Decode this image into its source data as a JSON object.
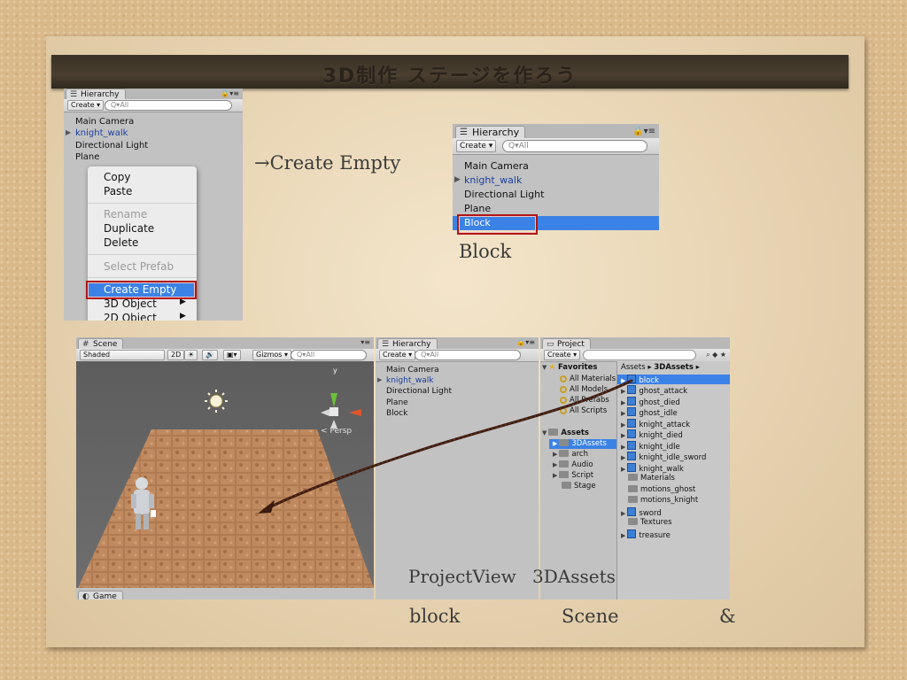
{
  "slide": {
    "title": "3D制作 ステージを作ろう",
    "note_create_empty": "→Create Empty",
    "note_block": "Block",
    "note_project_view": "ProjectView",
    "note_3dassets": "3DAssets",
    "note_block2": "block",
    "note_scene": "Scene",
    "note_amp": "&"
  },
  "hierarchy1": {
    "tab": "Hierarchy",
    "create": "Create ▾",
    "search_placeholder": "Q▾All",
    "items": [
      "Main Camera",
      "knight_walk",
      "Directional Light",
      "Plane"
    ]
  },
  "context_menu": {
    "items": [
      "Copy",
      "Paste",
      "Rename",
      "Duplicate",
      "Delete",
      "Select Prefab",
      "Create Empty",
      "3D Object",
      "2D Object"
    ]
  },
  "hierarchy2": {
    "tab": "Hierarchy",
    "create": "Create ▾",
    "search_placeholder": "Q▾All",
    "items": [
      "Main Camera",
      "knight_walk",
      "Directional Light",
      "Plane",
      "Block"
    ]
  },
  "scene": {
    "tab": "Scene",
    "shading": "Shaded",
    "btn_2d": "2D",
    "gizmos": "Gizmos ▾",
    "search_placeholder": "Q▾All",
    "gizmo_y": "y",
    "persp": "< Persp",
    "game_tab": "Game"
  },
  "hierarchy3": {
    "tab": "Hierarchy",
    "create": "Create ▾",
    "search_placeholder": "Q▾All",
    "items": [
      "Main Camera",
      "knight_walk",
      "Directional Light",
      "Plane",
      "Block"
    ]
  },
  "project": {
    "tab": "Project",
    "create": "Create ▾",
    "favorites": "Favorites",
    "favorites_items": [
      "All Materials",
      "All Models",
      "All Prefabs",
      "All Scripts"
    ],
    "assets": "Assets",
    "assets_items": [
      "3DAssets",
      "arch",
      "Audio",
      "Script",
      "Stage"
    ],
    "breadcrumb": [
      "Assets",
      "3DAssets"
    ],
    "files": [
      "block",
      "ghost_attack",
      "ghost_died",
      "ghost_idle",
      "knight_attack",
      "knight_died",
      "knight_idle",
      "knight_idle_sword",
      "knight_walk",
      "Materials",
      "motions_ghost",
      "motions_knight",
      "sword",
      "Textures",
      "treasure"
    ]
  },
  "colors": {
    "selection": "#3b82e6",
    "highlight_box": "#b01515",
    "panel": "#c2c2c2",
    "title_bar": "#3a3226"
  }
}
